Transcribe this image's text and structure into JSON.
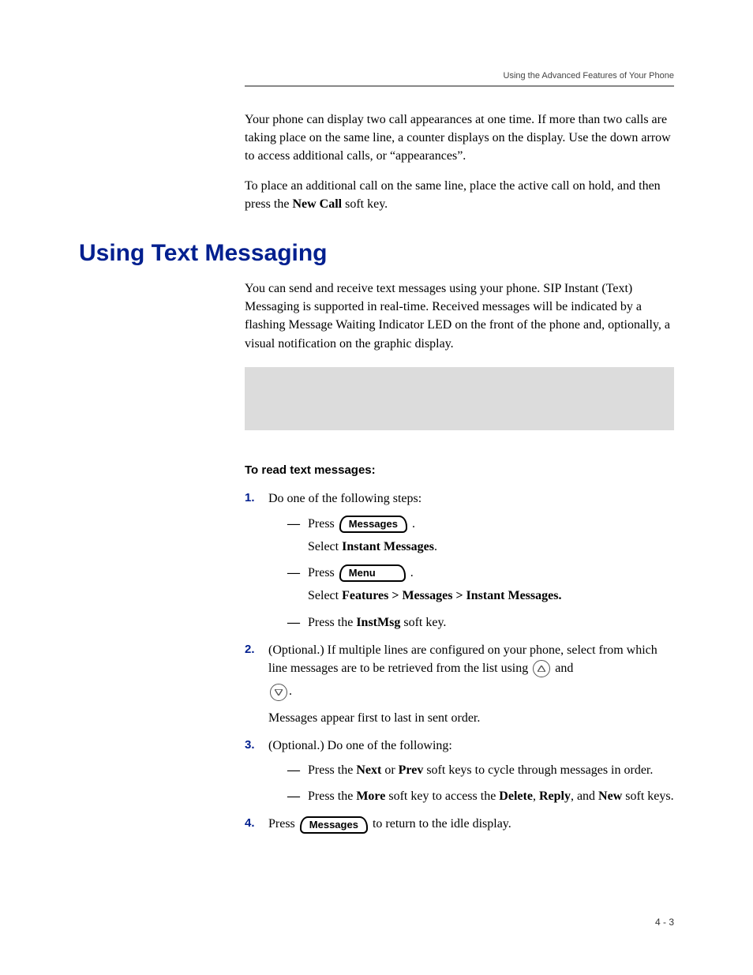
{
  "header": {
    "running_title": "Using the Advanced Features of Your Phone"
  },
  "intro": {
    "p1": "Your phone can display two call appearances at one time. If more than two calls are taking place on the same line, a counter displays on the display. Use the down arrow to access additional calls, or “appearances”.",
    "p2_a": "To place an additional call on the same line, place the active call on hold, and then press the ",
    "p2_bold": "New Call",
    "p2_b": " soft key."
  },
  "section": {
    "title": "Using Text Messaging",
    "p1": "You can send and receive text messages using your phone. SIP Instant (Text) Messaging is supported in real-time. Received messages will be indicated by a flashing Message Waiting Indicator LED on the front of the phone and, optionally, a visual notification on the graphic display."
  },
  "procedure": {
    "title": "To read text messages:",
    "step1": {
      "lead": "Do one of the following steps:",
      "opt1": {
        "press": "Press ",
        "button": "Messages",
        "select_a": "Select ",
        "select_bold": "Instant Messages",
        "select_b": "."
      },
      "opt2": {
        "press": "Press ",
        "button": "Menu",
        "select_a": "Select ",
        "select_bold": "Features > Messages > Instant Messages.",
        "select_b": ""
      },
      "opt3_a": "Press the ",
      "opt3_bold": "InstMsg",
      "opt3_b": " soft key."
    },
    "step2": {
      "line1_a": "(Optional.) If multiple lines are configured on your phone, select from which line messages are to be retrieved from the list using ",
      "line1_b": " and ",
      "line1_c": ".",
      "line2": "Messages appear first to last in sent order."
    },
    "step3": {
      "lead": "(Optional.) Do one of the following:",
      "opt1_a": "Press the ",
      "opt1_b1": "Next",
      "opt1_mid": " or ",
      "opt1_b2": "Prev",
      "opt1_c": " soft keys to cycle through messages in order.",
      "opt2_a": "Press the ",
      "opt2_b1": "More",
      "opt2_mid1": " soft key to access the ",
      "opt2_b2": "Delete",
      "opt2_mid2": ", ",
      "opt2_b3": "Reply",
      "opt2_mid3": ", and ",
      "opt2_b4": "New",
      "opt2_c": " soft keys."
    },
    "step4": {
      "a": "Press ",
      "button": "Messages",
      "b": " to return to the idle display."
    }
  },
  "footer": {
    "page_number": "4 - 3"
  }
}
